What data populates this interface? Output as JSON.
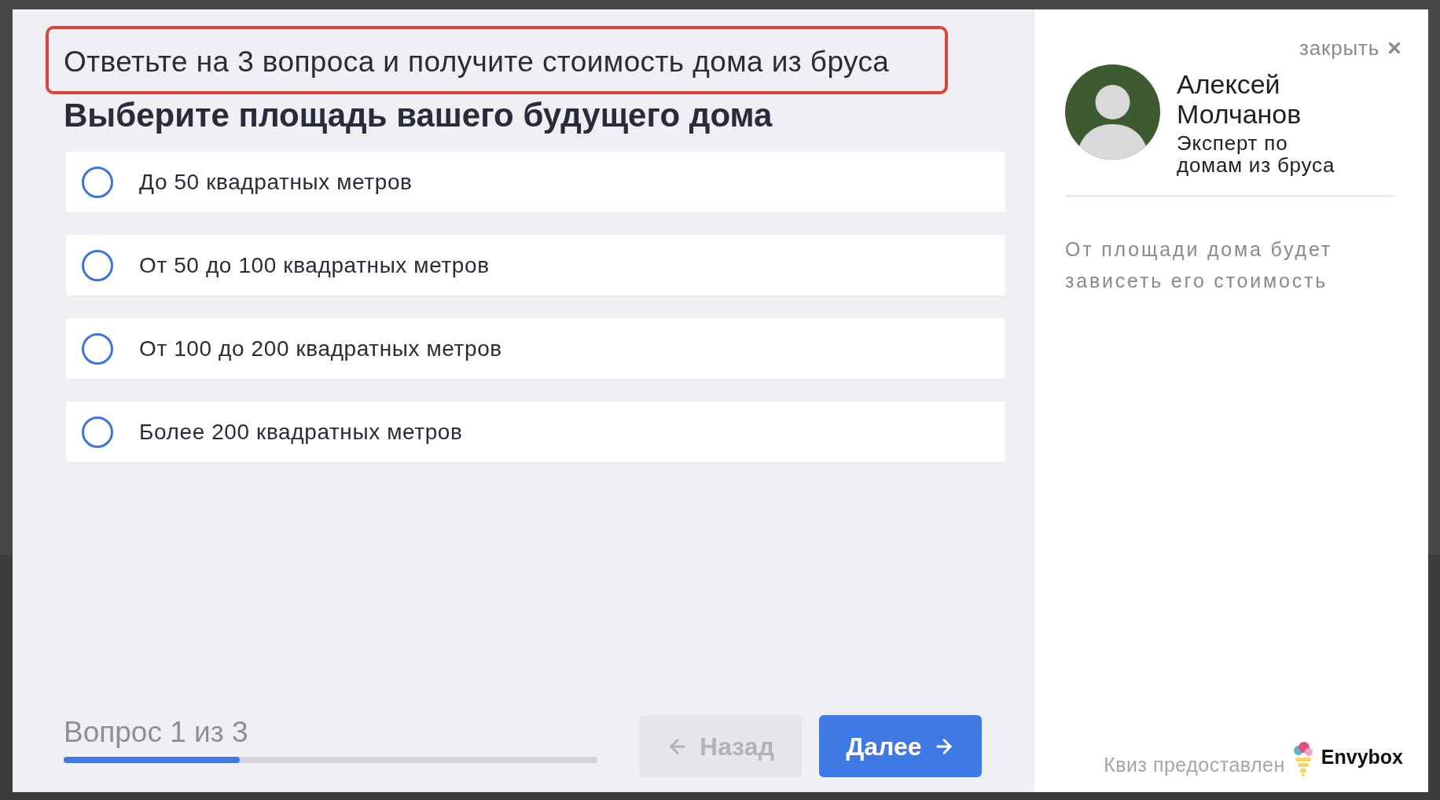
{
  "header": {
    "title": "Ответьте на 3 вопроса и получите стоимость дома из бруса"
  },
  "question": {
    "title": "Выберите площадь вашего будущего дома",
    "options": [
      {
        "label": "До 50 квадратных метров",
        "selected": false
      },
      {
        "label": "От 50 до 100 квадратных метров",
        "selected": false
      },
      {
        "label": "От 100 до 200 квадратных метров",
        "selected": false
      },
      {
        "label": "Более 200 квадратных метров",
        "selected": false
      }
    ]
  },
  "footer": {
    "progress_label": "Вопрос 1 из 3",
    "progress": {
      "level": 0.33
    },
    "buttons": [
      {
        "kind": "back",
        "label": "Назад",
        "disabled": true
      },
      {
        "kind": "next",
        "label": "Далее",
        "disabled": false
      }
    ]
  },
  "sidebar": {
    "close": {
      "label": "закрыть"
    },
    "expert": {
      "name": "Алексей Молчанов",
      "role": "Эксперт по домам из бруса"
    },
    "hint": "От площади дома будет зависеть его стоимость",
    "credit": {
      "text": "Квиз предоставлен",
      "brand": "Envybox"
    }
  }
}
